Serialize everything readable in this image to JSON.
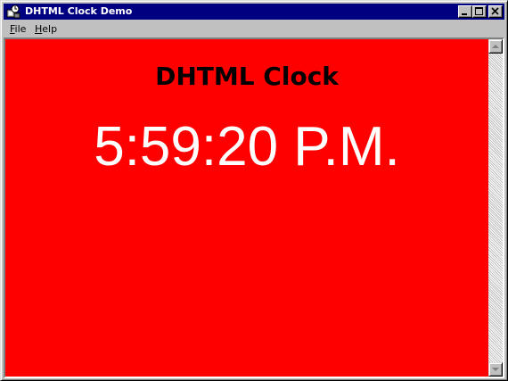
{
  "window": {
    "title": "DHTML Clock Demo",
    "title_bar_color": "#000080",
    "icons": {
      "app": "app-icon",
      "minimize": "minimize-icon",
      "maximize": "maximize-icon",
      "close": "close-icon"
    }
  },
  "menu": {
    "items": [
      {
        "label": "File"
      },
      {
        "label": "Help"
      }
    ]
  },
  "page": {
    "background_color": "#ff0000",
    "heading": "DHTML Clock",
    "heading_color": "#000000",
    "time": "5:59:20 P.M.",
    "time_color": "#ffffff"
  },
  "scrollbar": {
    "up_icon": "scroll-up-arrow-icon",
    "down_icon": "scroll-down-arrow-icon"
  }
}
